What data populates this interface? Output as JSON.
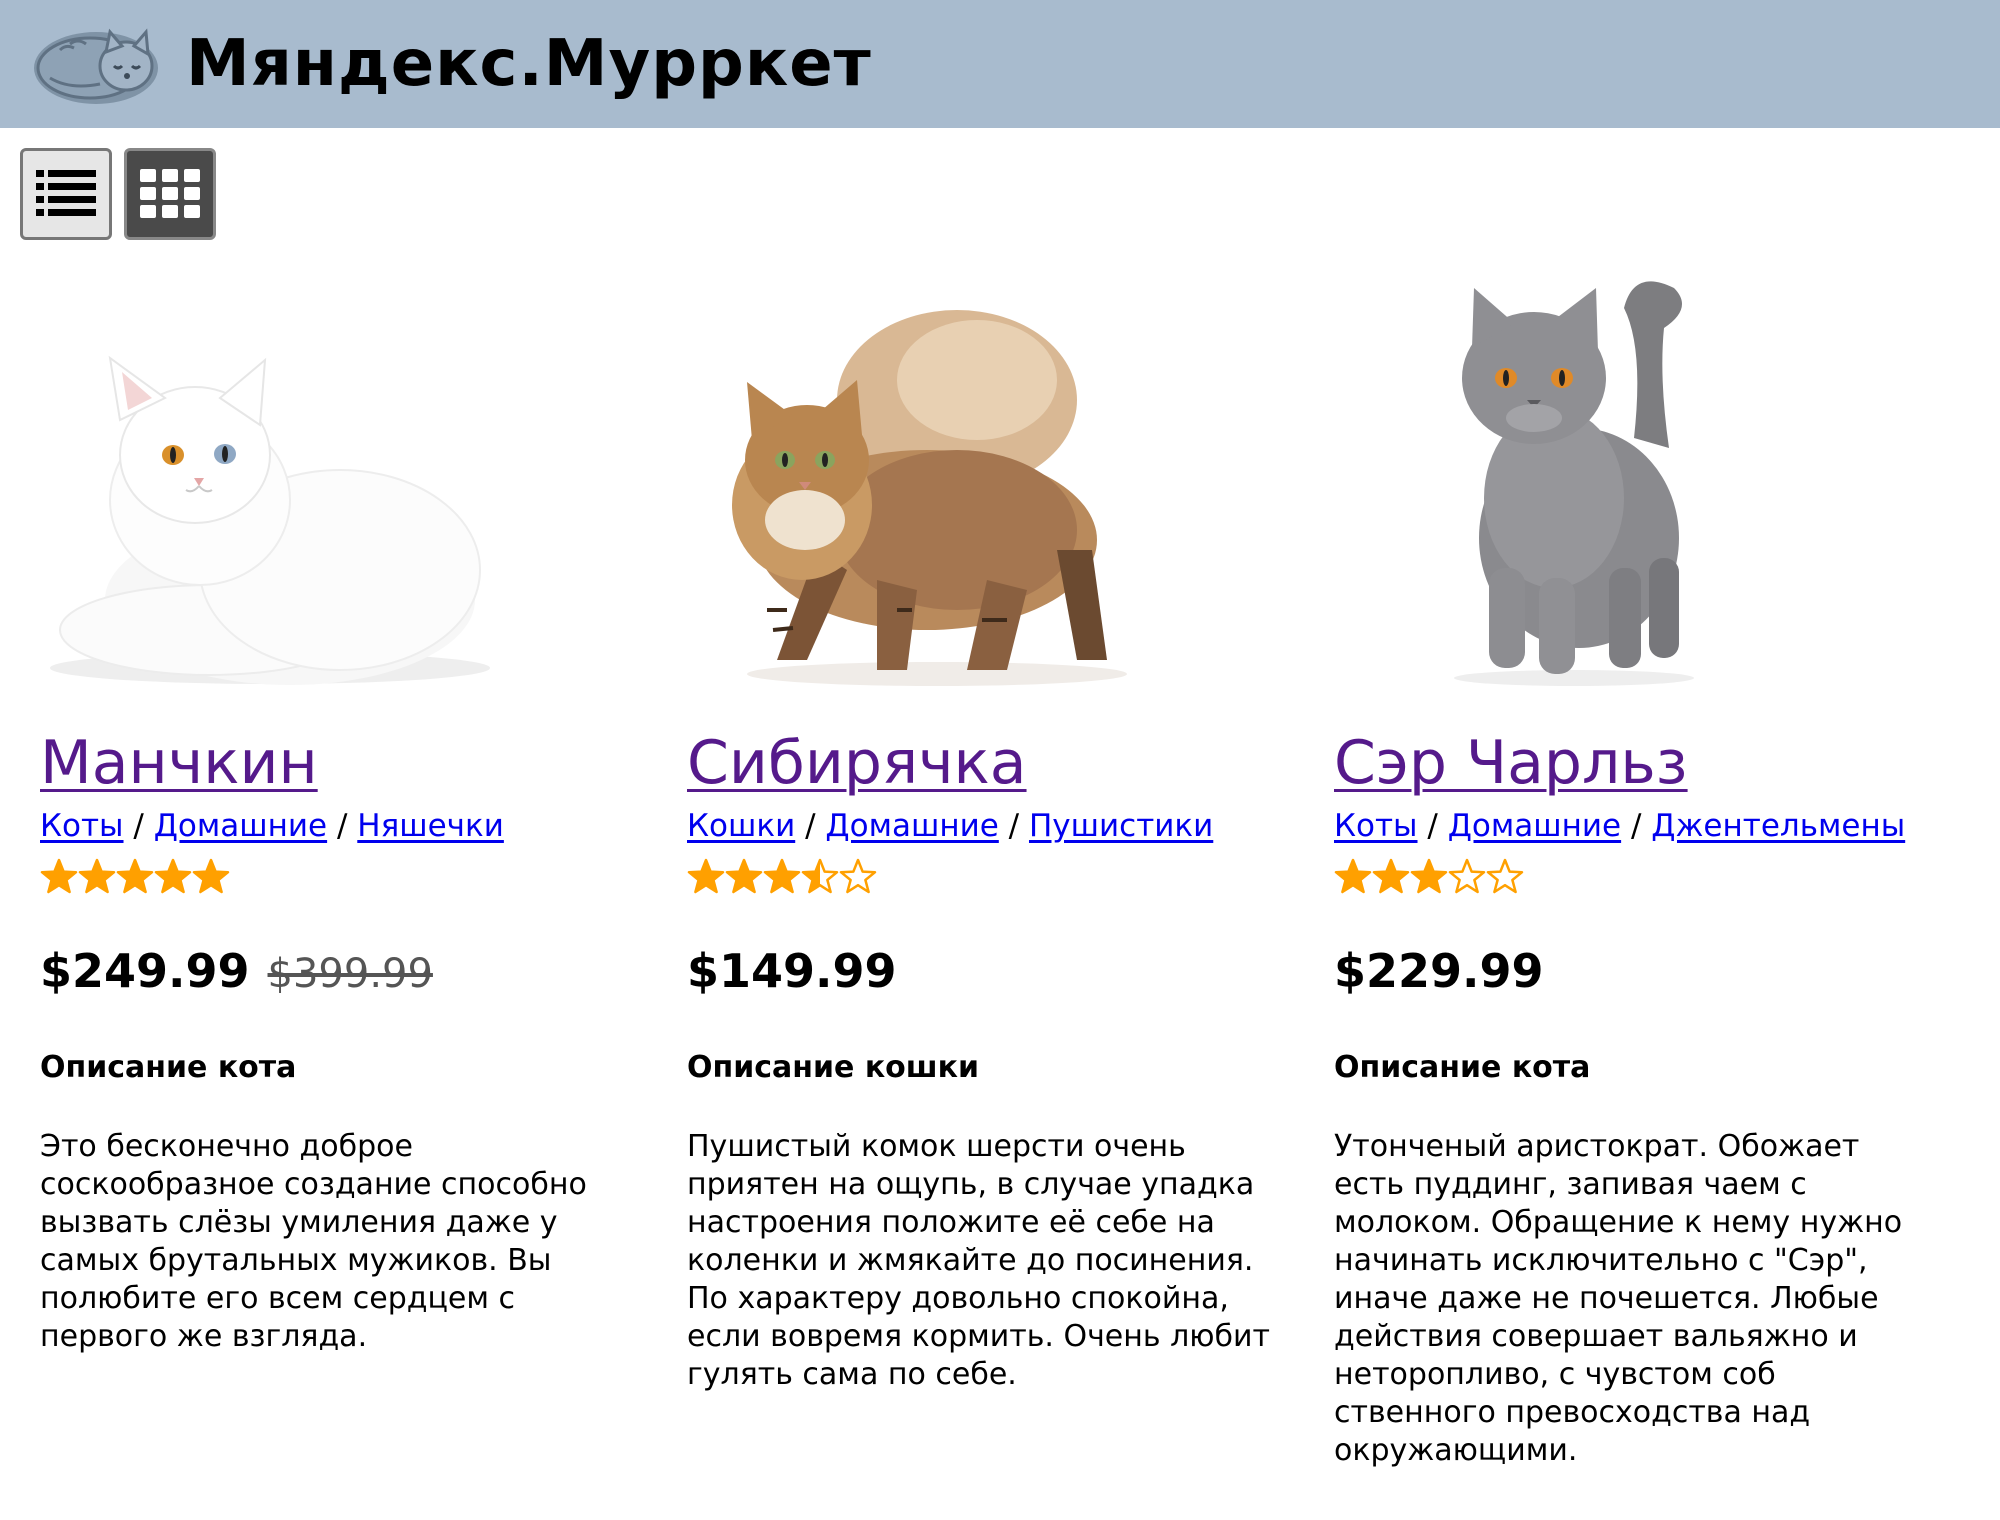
{
  "header": {
    "brand": "Мяндекс.Мурркет",
    "logo_icon": "sleeping-cat-icon"
  },
  "toolbar": {
    "list_view_icon": "list-view-icon",
    "grid_view_icon": "grid-view-icon"
  },
  "colors": {
    "header_bg": "#a8bbce",
    "link": "#0000ee",
    "visited_link": "#551a8b",
    "star": "#ffa000"
  },
  "products": [
    {
      "name": "Манчкин",
      "photo_icon": "white-cat-photo",
      "breadcrumbs": [
        "Коты",
        "Домашние",
        "Няшечки"
      ],
      "rating": 5,
      "price": "$249.99",
      "old_price": "$399.99",
      "description_title": "Описание кота",
      "description": "Это бесконечно доброе соскообразное создание способно вызвать слёзы умиления даже у самых брутальных мужиков. Вы полюбите его всем сердцем с первого же взгляда."
    },
    {
      "name": "Сибирячка",
      "photo_icon": "siberian-cat-photo",
      "breadcrumbs": [
        "Кошки",
        "Домашние",
        "Пушистики"
      ],
      "rating": 3.5,
      "price": "$149.99",
      "old_price": "",
      "description_title": "Описание кошки",
      "description": "Пушистый комок шерсти очень приятен на ощупь, в случае упадка настроения положите её себе на коленки и жмякайте до посинения. По характеру довольно спокойна, если вовремя кормить. Очень любит гулять сама по себе."
    },
    {
      "name": "Сэр Чарльз",
      "photo_icon": "british-gray-cat-photo",
      "breadcrumbs": [
        "Коты",
        "Домашние",
        "Джентельмены"
      ],
      "rating": 3,
      "price": "$229.99",
      "old_price": "",
      "description_title": "Описание кота",
      "description": "Утонченый аристократ. Обожает есть пуддинг, запивая чаем с молоком. Обращение к нему нужно начинать исключительно с \"Сэр\", иначе даже не почешется. Любые действия совершает вальяжно и неторопливо, с чувстом соб ственного превосходства над окружающими."
    }
  ]
}
